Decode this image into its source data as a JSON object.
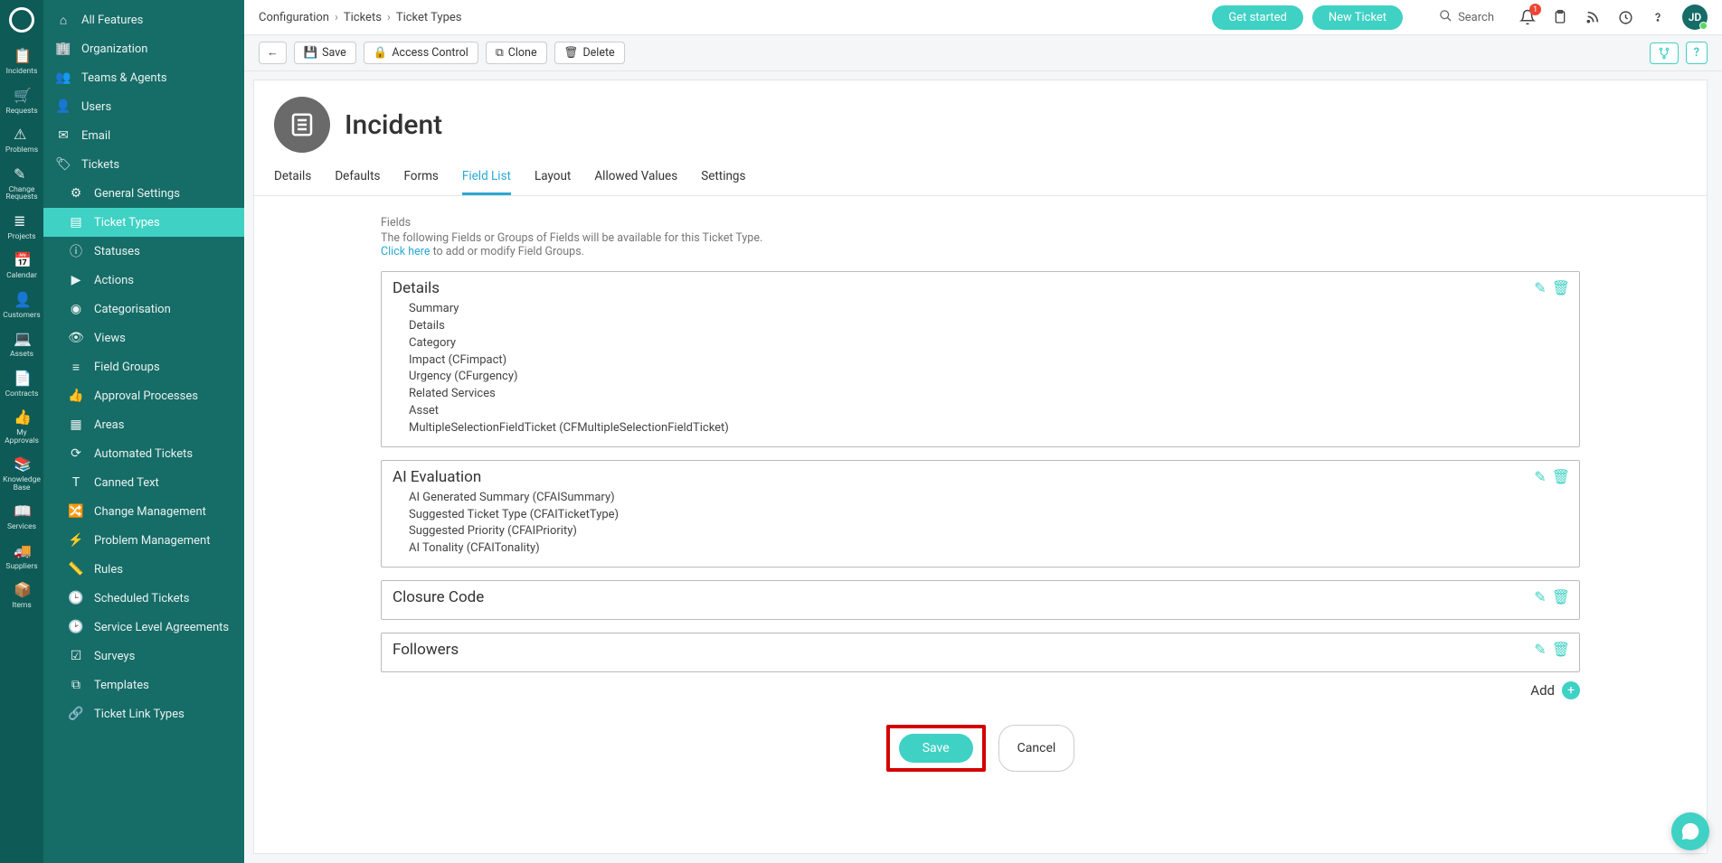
{
  "rail": {
    "items": [
      {
        "label": "Incidents"
      },
      {
        "label": "Requests"
      },
      {
        "label": "Problems"
      },
      {
        "label": "Change Requests"
      },
      {
        "label": "Projects"
      },
      {
        "label": "Calendar"
      },
      {
        "label": "Customers"
      },
      {
        "label": "Assets"
      },
      {
        "label": "Contracts"
      },
      {
        "label": "My Approvals"
      },
      {
        "label": "Knowledge Base"
      },
      {
        "label": "Services"
      },
      {
        "label": "Suppliers"
      },
      {
        "label": "Items"
      }
    ]
  },
  "sidenav": {
    "items": [
      {
        "label": "All Features",
        "icon": "home-icon"
      },
      {
        "label": "Organization",
        "icon": "org-icon"
      },
      {
        "label": "Teams & Agents",
        "icon": "teams-icon"
      },
      {
        "label": "Users",
        "icon": "users-icon"
      },
      {
        "label": "Email",
        "icon": "email-icon"
      },
      {
        "label": "Tickets",
        "icon": "tickets-icon"
      },
      {
        "label": "General Settings",
        "icon": "gear-icon",
        "sub": true
      },
      {
        "label": "Ticket Types",
        "icon": "ticket-types-icon",
        "sub": true,
        "active": true
      },
      {
        "label": "Statuses",
        "icon": "info-icon",
        "sub": true
      },
      {
        "label": "Actions",
        "icon": "play-icon",
        "sub": true
      },
      {
        "label": "Categorisation",
        "icon": "category-icon",
        "sub": true
      },
      {
        "label": "Views",
        "icon": "views-icon",
        "sub": true
      },
      {
        "label": "Field Groups",
        "icon": "fields-icon",
        "sub": true
      },
      {
        "label": "Approval Processes",
        "icon": "approval-icon",
        "sub": true
      },
      {
        "label": "Areas",
        "icon": "areas-icon",
        "sub": true
      },
      {
        "label": "Automated Tickets",
        "icon": "auto-icon",
        "sub": true
      },
      {
        "label": "Canned Text",
        "icon": "text-icon",
        "sub": true
      },
      {
        "label": "Change Management",
        "icon": "change-icon",
        "sub": true
      },
      {
        "label": "Problem Management",
        "icon": "problem-icon",
        "sub": true
      },
      {
        "label": "Rules",
        "icon": "rules-icon",
        "sub": true
      },
      {
        "label": "Scheduled Tickets",
        "icon": "schedule-icon",
        "sub": true
      },
      {
        "label": "Service Level Agreements",
        "icon": "sla-icon",
        "sub": true
      },
      {
        "label": "Surveys",
        "icon": "survey-icon",
        "sub": true
      },
      {
        "label": "Templates",
        "icon": "templates-icon",
        "sub": true
      },
      {
        "label": "Ticket Link Types",
        "icon": "link-icon",
        "sub": true
      }
    ]
  },
  "topbar": {
    "breadcrumb": [
      "Configuration",
      "Tickets",
      "Ticket Types"
    ],
    "get_started": "Get started",
    "new_ticket": "New Ticket",
    "search_placeholder": "Search",
    "notif_count": "1",
    "avatar_initials": "JD"
  },
  "actions": {
    "save": "Save",
    "access": "Access Control",
    "clone": "Clone",
    "delete": "Delete"
  },
  "page": {
    "title": "Incident",
    "tabs": [
      "Details",
      "Defaults",
      "Forms",
      "Field List",
      "Layout",
      "Allowed Values",
      "Settings"
    ],
    "active_tab": "Field List"
  },
  "fields_section": {
    "label": "Fields",
    "desc": "The following Fields or Groups of Fields will be available for this Ticket Type.",
    "link_text": "Click here",
    "link_suffix": " to add or modify Field Groups."
  },
  "groups": [
    {
      "title": "Details",
      "fields": [
        "Summary",
        "Details",
        "Category",
        "Impact (CFimpact)",
        "Urgency (CFurgency)",
        "Related Services",
        "Asset",
        "MultipleSelectionFieldTicket (CFMultipleSelectionFieldTicket)"
      ]
    },
    {
      "title": "AI Evaluation",
      "fields": [
        "AI Generated Summary (CFAISummary)",
        "Suggested Ticket Type (CFAITicketType)",
        "Suggested Priority (CFAIPriority)",
        "AI Tonality (CFAITonality)"
      ]
    },
    {
      "title": "Closure Code",
      "fields": []
    },
    {
      "title": "Followers",
      "fields": []
    }
  ],
  "add_label": "Add",
  "bottom": {
    "save": "Save",
    "cancel": "Cancel"
  }
}
